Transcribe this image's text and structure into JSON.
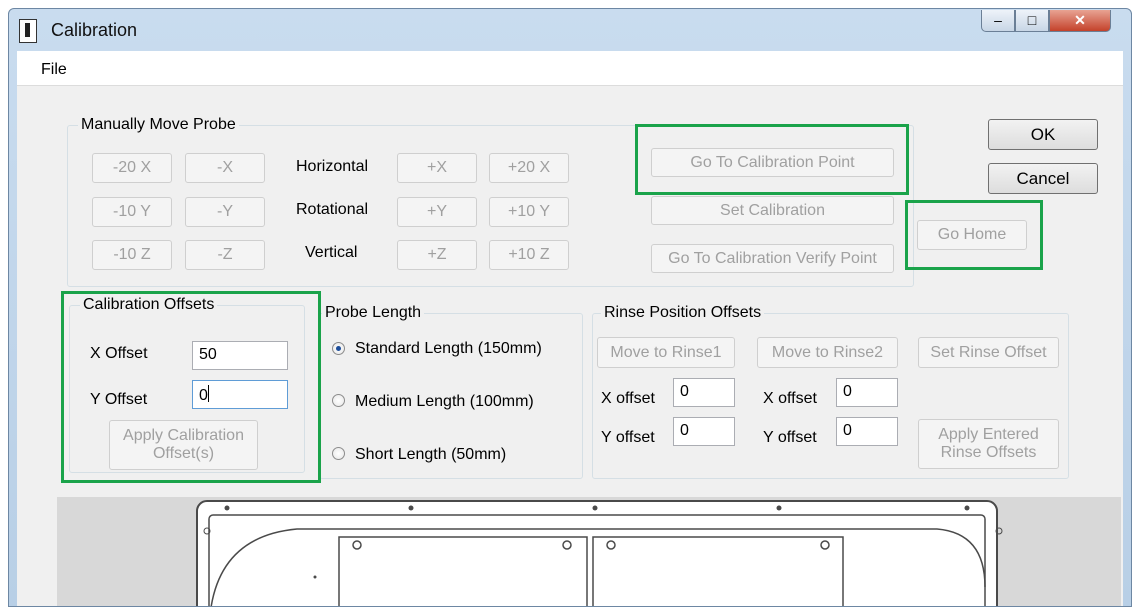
{
  "window": {
    "title": "Calibration",
    "controls": {
      "minimize": "–",
      "maximize": "□",
      "close": "✕"
    }
  },
  "menu": {
    "file": "File"
  },
  "manual_move": {
    "legend": "Manually Move Probe",
    "rows": [
      {
        "label": "Horizontal",
        "buttons": [
          "-20 X",
          "-X",
          "+X",
          "+20 X"
        ]
      },
      {
        "label": "Rotational",
        "buttons": [
          "-10 Y",
          "-Y",
          "+Y",
          "+10 Y"
        ]
      },
      {
        "label": "Vertical",
        "buttons": [
          "-10 Z",
          "-Z",
          "+Z",
          "+10 Z"
        ]
      }
    ]
  },
  "calibration_actions": {
    "go_to_point": "Go To Calibration Point",
    "set_calibration": "Set Calibration",
    "go_to_verify": "Go To Calibration Verify Point",
    "go_home": "Go Home"
  },
  "dialog": {
    "ok": "OK",
    "cancel": "Cancel"
  },
  "calibration_offsets": {
    "legend": "Calibration Offsets",
    "x_label": "X Offset",
    "x_value": "50",
    "y_label": "Y Offset",
    "y_value": "0",
    "apply_line1": "Apply Calibration",
    "apply_line2": "Offset(s)"
  },
  "probe_length": {
    "legend": "Probe Length",
    "options": [
      {
        "label": "Standard Length (150mm)",
        "selected": true
      },
      {
        "label": "Medium Length (100mm)",
        "selected": false
      },
      {
        "label": "Short Length (50mm)",
        "selected": false
      }
    ]
  },
  "rinse": {
    "legend": "Rinse Position Offsets",
    "move1": "Move to Rinse1",
    "move2": "Move to Rinse2",
    "set": "Set Rinse Offset",
    "x_label": "X offset",
    "y_label": "Y offset",
    "rinse1_x": "0",
    "rinse1_y": "0",
    "rinse2_x": "0",
    "rinse2_y": "0",
    "apply_line1": "Apply Entered",
    "apply_line2": "Rinse Offsets"
  },
  "colors": {
    "highlight": "#1aa34a"
  }
}
